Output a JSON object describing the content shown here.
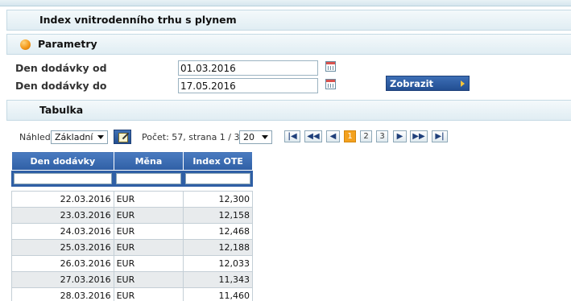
{
  "header": {
    "title": "Index vnitrodenního trhu s plynem"
  },
  "params": {
    "title": "Parametry",
    "date_from_label": "Den dodávky od",
    "date_from_value": "01.03.2016",
    "date_to_label": "Den dodávky do",
    "date_to_value": "17.05.2016",
    "show_button": "Zobrazit"
  },
  "table_section": {
    "title": "Tabulka"
  },
  "toolbar": {
    "view_label": "Náhled:",
    "view_selected": "Základní",
    "count_text": "Počet: 57, strana 1 / 3.",
    "page_size": "20",
    "pager": {
      "first": "|◀",
      "prev_block": "◀◀",
      "prev": "◀",
      "pages": [
        "1",
        "2",
        "3"
      ],
      "active_page": "1",
      "next": "▶",
      "next_block": "▶▶",
      "last": "▶|"
    }
  },
  "grid": {
    "columns": [
      "Den dodávky",
      "Měna",
      "Index OTE"
    ],
    "rows": [
      {
        "date": "22.03.2016",
        "currency": "EUR",
        "index": "12,300"
      },
      {
        "date": "23.03.2016",
        "currency": "EUR",
        "index": "12,158"
      },
      {
        "date": "24.03.2016",
        "currency": "EUR",
        "index": "12,468"
      },
      {
        "date": "25.03.2016",
        "currency": "EUR",
        "index": "12,188"
      },
      {
        "date": "26.03.2016",
        "currency": "EUR",
        "index": "12,033"
      },
      {
        "date": "27.03.2016",
        "currency": "EUR",
        "index": "11,343"
      },
      {
        "date": "28.03.2016",
        "currency": "EUR",
        "index": "11,460"
      }
    ]
  },
  "colors": {
    "accent_blue": "#2f5fa5",
    "active_page": "#f4a11e",
    "section_border": "#c5dae4"
  }
}
